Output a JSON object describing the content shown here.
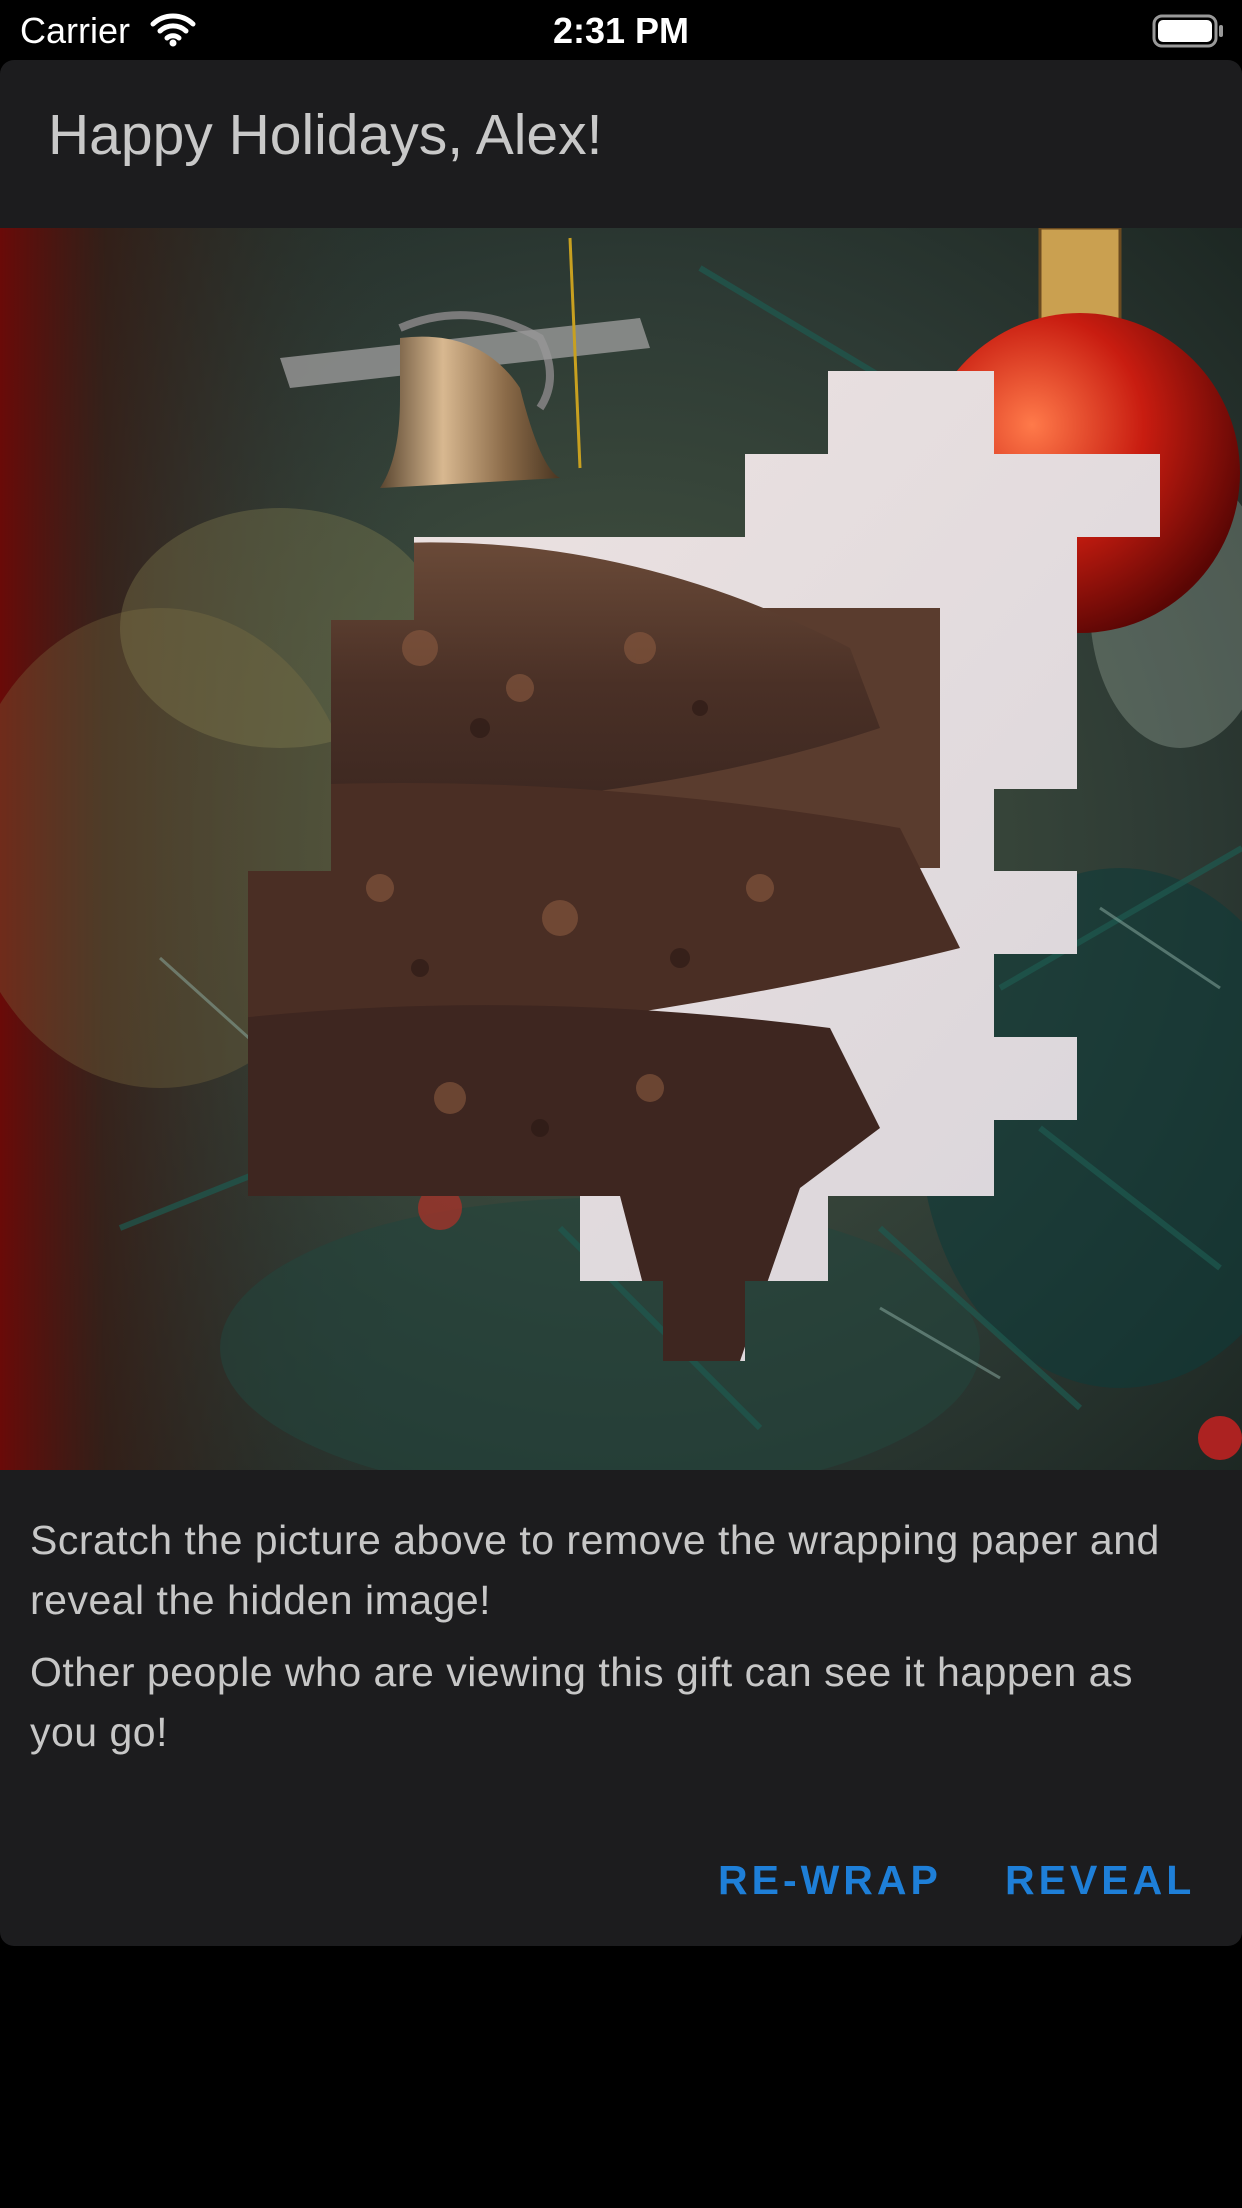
{
  "status_bar": {
    "carrier": "Carrier",
    "time": "2:31 PM",
    "wifi_icon": "wifi-icon",
    "battery_icon": "battery-full-icon"
  },
  "card": {
    "title": "Happy Holidays, Alex!",
    "scratch_image": {
      "wrapping_paper": "christmas-tree-with-bell-and-red-ornament",
      "hidden_image": "stacked-chocolate-brownies"
    },
    "description_1": "Scratch the picture above to remove the wrapping paper and reveal the hidden image!",
    "description_2": "Other people who are viewing this gift can see it happen as you go!",
    "rewrap_label": "RE-WRAP",
    "reveal_label": "REVEAL"
  },
  "colors": {
    "background": "#000000",
    "card_background": "#1c1c1e",
    "title_text": "#c8c8c8",
    "body_text": "#c7c7c7",
    "action_blue": "#1e7fd8"
  }
}
